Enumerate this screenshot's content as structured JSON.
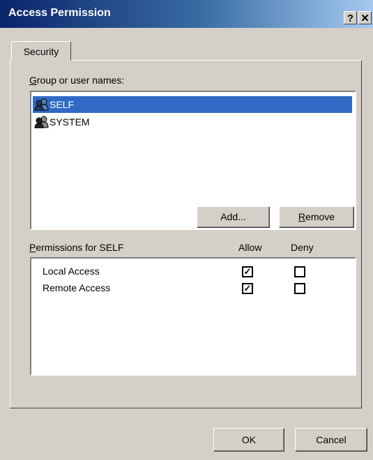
{
  "window": {
    "title": "Access Permission",
    "help_glyph": "?",
    "close_glyph": "✕"
  },
  "tabs": [
    {
      "label": "Security"
    }
  ],
  "group_section": {
    "label": "Group or user names:",
    "users": [
      {
        "name": "SELF",
        "selected": true,
        "icon": "group-user-icon"
      },
      {
        "name": "SYSTEM",
        "selected": false,
        "icon": "group-user-icon"
      }
    ],
    "add_label": "Add...",
    "remove_label": "Remove"
  },
  "permissions": {
    "label": "Permissions for SELF",
    "allow_header": "Allow",
    "deny_header": "Deny",
    "rows": [
      {
        "name": "Local Access",
        "allow": true,
        "deny": false
      },
      {
        "name": "Remote Access",
        "allow": true,
        "deny": false
      }
    ]
  },
  "buttons": {
    "ok_label": "OK",
    "cancel_label": "Cancel"
  },
  "colors": {
    "titlebar_start": "#0a246a",
    "titlebar_end": "#a6caf0",
    "selection": "#316ac5",
    "face": "#d4d0c8"
  }
}
